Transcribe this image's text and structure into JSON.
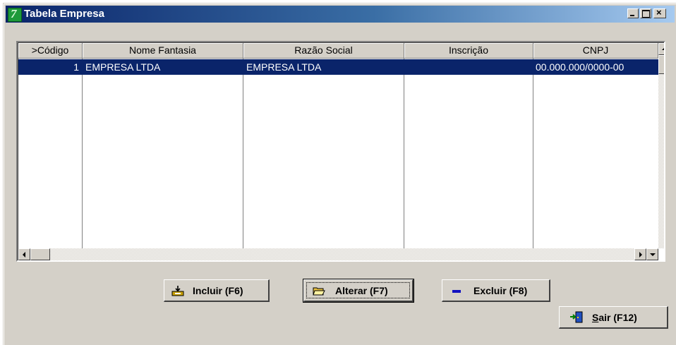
{
  "window": {
    "title": "Tabela Empresa"
  },
  "table": {
    "columns": [
      ">Código",
      "Nome Fantasia",
      "Razão Social",
      "Inscrição",
      "CNPJ"
    ],
    "rows": [
      {
        "codigo": "1",
        "nome_fantasia": "EMPRESA LTDA",
        "razao_social": "EMPRESA LTDA",
        "inscricao": "",
        "cnpj": "00.000.000/0000-00"
      }
    ],
    "selected_row": 0
  },
  "buttons": {
    "incluir": "Incluir (F6)",
    "alterar": "Alterar (F7)",
    "excluir": "Excluir (F8)",
    "sair": "Sair (F12)"
  },
  "colors": {
    "title_start": "#0a246a",
    "title_end": "#a6caf0",
    "selection": "#0a246a",
    "face": "#d4d0c8"
  },
  "icons": {
    "incluir": "add-record-icon",
    "alterar": "open-folder-icon",
    "excluir": "minus-icon",
    "sair": "exit-door-icon",
    "app": "app-logo-icon"
  }
}
